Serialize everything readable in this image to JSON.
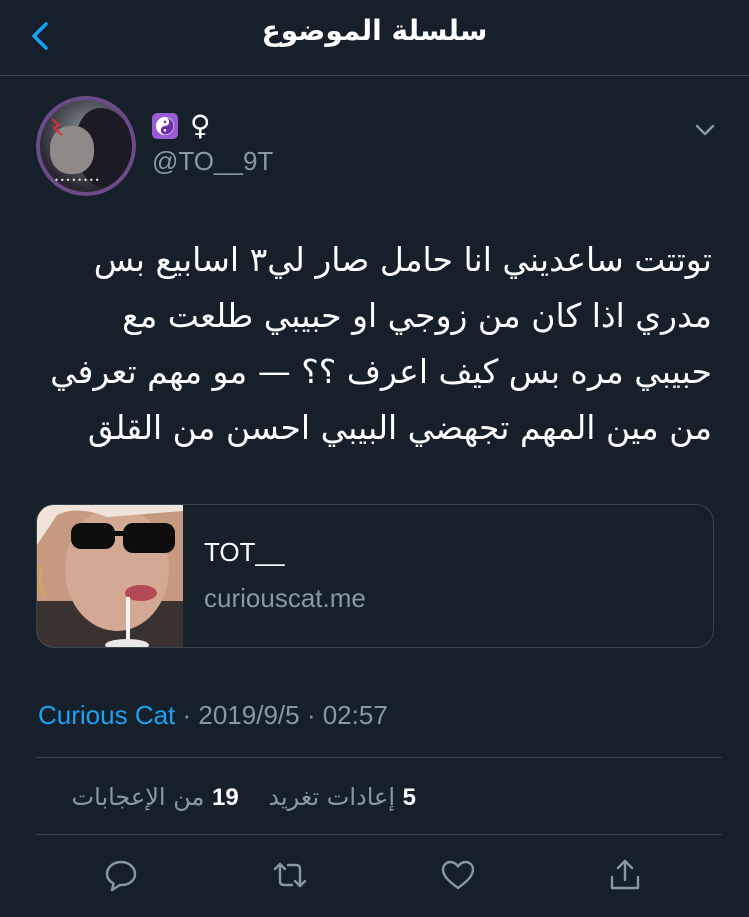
{
  "header": {
    "title": "سلسلة الموضوع",
    "back_icon": "chevron-left-icon",
    "accent_color": "#1da1f2"
  },
  "tweet": {
    "badge_icon": "yin-yang-icon",
    "badge_color": "#9a5cd6",
    "gender_symbol": "♀",
    "handle": "@TO__9T",
    "avatar_caption": "••••••••",
    "text": "توتتت ساعديني انا حامل صار لي٣ اسابيع بس\nمدري اذا كان من زوجي او حبيبي طلعت مع\nحبيبي مره بس كيف اعرف ؟؟ — مو مهم تعرفي\nمن مين المهم تجهضي البيبي احسن من القلق"
  },
  "card": {
    "title": "TOT__",
    "domain": "curiouscat.me"
  },
  "meta": {
    "source": "Curious Cat",
    "separator": " · ",
    "date": "2019/9/5",
    "time": "02:57"
  },
  "stats": {
    "retweets_count": "5",
    "retweets_label": "إعادات تغريد",
    "likes_count": "19",
    "likes_label": "من الإعجابات"
  },
  "actions": {
    "reply_icon": "reply-icon",
    "retweet_icon": "retweet-icon",
    "like_icon": "heart-icon",
    "share_icon": "share-icon"
  },
  "colors": {
    "background": "#15202b",
    "divider": "#38444d",
    "secondary_text": "#8899a6",
    "link": "#1da1f2"
  }
}
